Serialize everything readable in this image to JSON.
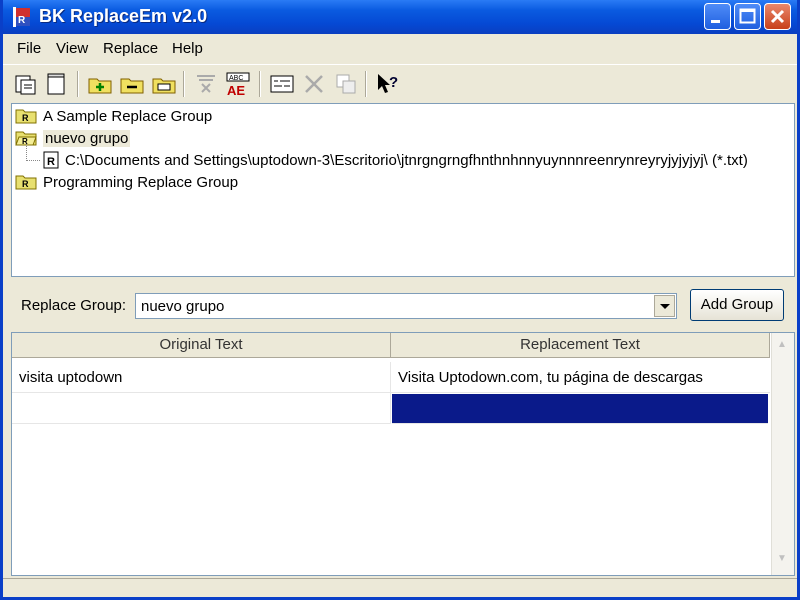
{
  "window": {
    "title": "BK ReplaceEm v2.0",
    "accent": "#0a5be0",
    "close_color": "#c8401a"
  },
  "menu": {
    "items": [
      "File",
      "View",
      "Replace",
      "Help"
    ]
  },
  "toolbar": {
    "icons": [
      "open-icon",
      "new-file-icon",
      "add-group-icon",
      "remove-group-icon",
      "rename-group-icon",
      "filter-icon",
      "replace-ae-icon",
      "options-icon",
      "delete-icon",
      "properties-icon",
      "help-pointer-icon"
    ]
  },
  "tree": {
    "groups": [
      {
        "label": "A Sample Replace Group"
      },
      {
        "label": "nuevo grupo",
        "selected": true,
        "files": [
          {
            "path": "C:\\Documents and Settings\\uptodown-3\\Escritorio\\jtnrgngrngfhnthnhnnyuynnnreenrynreyryjyjyjyj\\ (*.txt)"
          }
        ]
      },
      {
        "label": "Programming Replace Group"
      }
    ]
  },
  "replace_group": {
    "label": "Replace Group:",
    "selected": "nuevo grupo",
    "add_button": "Add Group"
  },
  "grid": {
    "headers": [
      "Original Text",
      "Replacement Text"
    ],
    "rows": [
      {
        "original": "visita uptodown",
        "replacement": "Visita Uptodown.com, tu página de descargas"
      },
      {
        "original": "",
        "replacement": "",
        "selected": true
      }
    ],
    "selection_color": "#0a1a8a"
  }
}
